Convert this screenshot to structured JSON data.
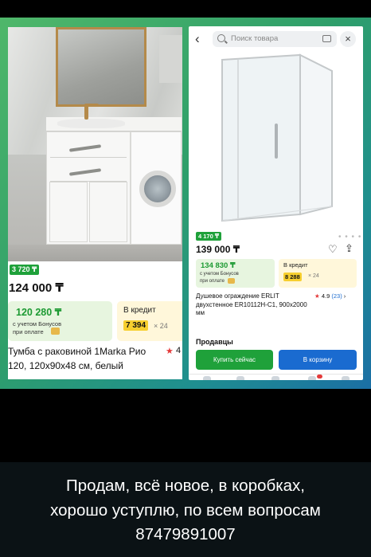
{
  "left_product": {
    "badge": "3 720 ₸",
    "price": "124 000 ₸",
    "bonus_price": "120 280 ₸",
    "bonus_text_1": "с учетом Бонусов",
    "bonus_text_2": "при оплате",
    "credit_label": "В кредит",
    "credit_amount": "7 394",
    "credit_term": "× 24",
    "name_line_1": "Тумба с раковиной 1Marka Рио",
    "name_line_2": "120, 120х90х48 см, белый",
    "rating_star": "★",
    "rating_partial": "4"
  },
  "right_product": {
    "back_icon": "‹",
    "search_placeholder": "Поиск товара",
    "close_icon": "×",
    "badge": "4 170 ₸",
    "price": "139 000 ₸",
    "heart_icon": "♡",
    "share_icon": "⇪",
    "gallery_dots": "• • • •",
    "bonus_price": "134 830 ₸",
    "bonus_text_1": "с учетом Бонусов",
    "bonus_text_2": "при оплате",
    "credit_label": "В кредит",
    "credit_amount": "8 288",
    "credit_term": "× 24",
    "name": "Душевое ограждение ERLIT двухстенное ER10112H-C1, 900х2000 мм",
    "rating_star": "★",
    "rating_value": "4.9",
    "rating_count": "(23)",
    "rating_chevron": "›",
    "sellers_label": "Продавцы",
    "buy_now": "Купить сейчас",
    "to_cart": "В корзину"
  },
  "caption": {
    "line_1": "Продам, всё новое, в коробках,",
    "line_2": "хорошо уступлю, по всем вопросам",
    "line_3": "87479891007"
  },
  "colors": {
    "green": "#1fa13a",
    "blue": "#1a6bd0",
    "credit_yellow": "#f7cf2f"
  }
}
